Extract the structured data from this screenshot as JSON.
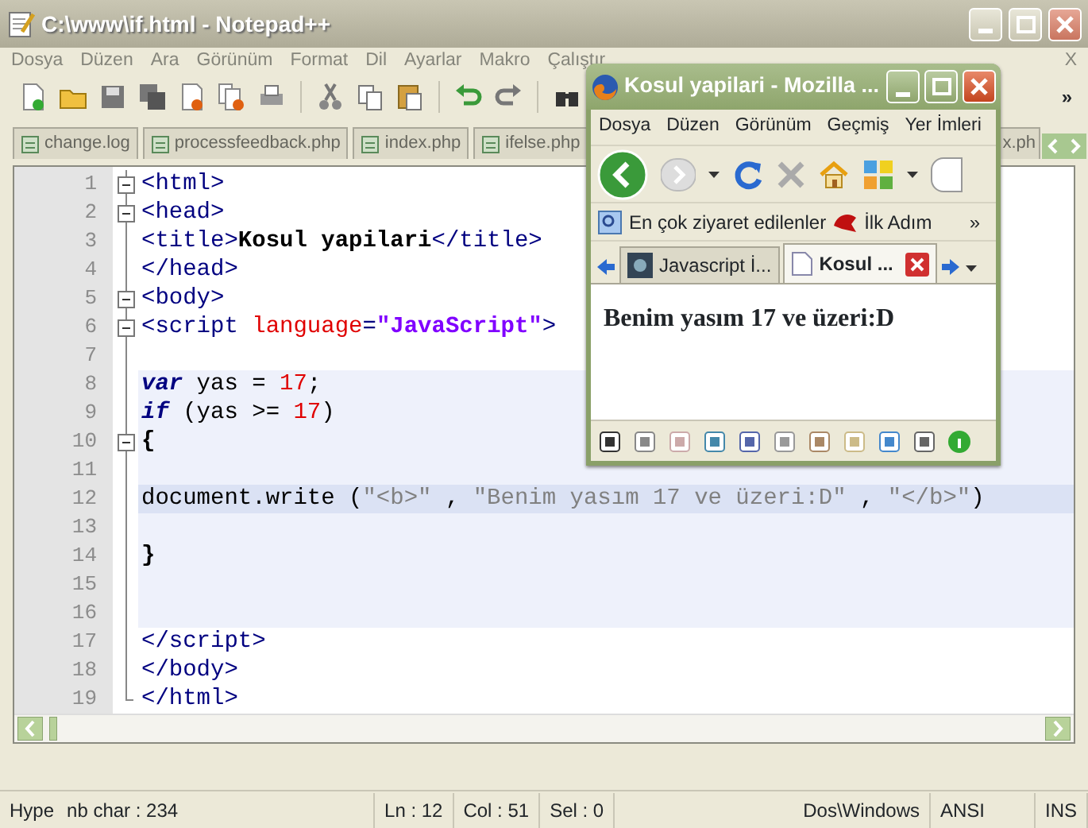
{
  "editor_window": {
    "title": "C:\\www\\if.html - Notepad++",
    "menu": [
      "Dosya",
      "Düzen",
      "Ara",
      "Görünüm",
      "Format",
      "Dil",
      "Ayarlar",
      "Makro",
      "Çalıştır"
    ],
    "menu_close": "X",
    "toolbar_overflow": "»",
    "tabs": [
      {
        "label": "change.log",
        "selected": false
      },
      {
        "label": "processfeedback.php",
        "selected": false
      },
      {
        "label": "index.php",
        "selected": false
      },
      {
        "label": "ifelse.php",
        "selected": false
      },
      {
        "label": "x.ph",
        "selected": false
      }
    ],
    "lines": [
      {
        "number": "1",
        "foldable": true,
        "shaded": false,
        "current": false,
        "tokens": [
          {
            "kind": "tag",
            "text": "<html>"
          }
        ]
      },
      {
        "number": "2",
        "foldable": true,
        "shaded": false,
        "current": false,
        "tokens": [
          {
            "kind": "tag",
            "text": "<head>"
          }
        ]
      },
      {
        "number": "3",
        "foldable": false,
        "shaded": false,
        "current": false,
        "tokens": [
          {
            "kind": "tag",
            "text": "<title>"
          },
          {
            "kind": "bold",
            "text": "Kosul yapilari"
          },
          {
            "kind": "tag",
            "text": "</title>"
          }
        ]
      },
      {
        "number": "4",
        "foldable": false,
        "shaded": false,
        "current": false,
        "tokens": [
          {
            "kind": "tag",
            "text": "</head>"
          }
        ]
      },
      {
        "number": "5",
        "foldable": true,
        "shaded": false,
        "current": false,
        "tokens": [
          {
            "kind": "tag",
            "text": "<body>"
          }
        ]
      },
      {
        "number": "6",
        "foldable": true,
        "shaded": false,
        "current": false,
        "tokens": [
          {
            "kind": "tag",
            "text": "<script "
          },
          {
            "kind": "attr",
            "text": "language"
          },
          {
            "kind": "tag",
            "text": "="
          },
          {
            "kind": "value",
            "text": "\"JavaScript\""
          },
          {
            "kind": "tag",
            "text": ">"
          }
        ]
      },
      {
        "number": "7",
        "foldable": false,
        "shaded": false,
        "current": false
      },
      {
        "number": "8",
        "foldable": false,
        "shaded": true,
        "current": false,
        "tokens": [
          {
            "kind": "keyword",
            "text": "var"
          },
          {
            "kind": "plain",
            "text": " yas = "
          },
          {
            "kind": "number",
            "text": "17"
          },
          {
            "kind": "plain",
            "text": ";"
          }
        ]
      },
      {
        "number": "9",
        "foldable": false,
        "shaded": true,
        "current": false,
        "tokens": [
          {
            "kind": "keyword",
            "text": "if"
          },
          {
            "kind": "plain",
            "text": " (yas >= "
          },
          {
            "kind": "number",
            "text": "17"
          },
          {
            "kind": "plain",
            "text": ")"
          }
        ]
      },
      {
        "number": "10",
        "foldable": true,
        "shaded": true,
        "current": false,
        "tokens": [
          {
            "kind": "bold",
            "text": "{"
          }
        ]
      },
      {
        "number": "11",
        "foldable": false,
        "shaded": true,
        "current": false
      },
      {
        "number": "12",
        "foldable": false,
        "shaded": true,
        "current": true,
        "tokens": [
          {
            "kind": "plain",
            "text": "document.write ("
          },
          {
            "kind": "string",
            "text": "\"<b>\" "
          },
          {
            "kind": "plain",
            "text": ", "
          },
          {
            "kind": "string",
            "text": "\"Benim yasım 17 ve üzeri:D\" "
          },
          {
            "kind": "plain",
            "text": ", "
          },
          {
            "kind": "string",
            "text": "\"</b>\""
          },
          {
            "kind": "plain",
            "text": ")"
          }
        ]
      },
      {
        "number": "13",
        "foldable": false,
        "shaded": true,
        "current": false
      },
      {
        "number": "14",
        "foldable": false,
        "shaded": true,
        "current": false,
        "tokens": [
          {
            "kind": "bold",
            "text": "}"
          }
        ]
      },
      {
        "number": "15",
        "foldable": false,
        "shaded": true,
        "current": false
      },
      {
        "number": "16",
        "foldable": false,
        "shaded": true,
        "current": false
      },
      {
        "number": "17",
        "foldable": false,
        "shaded": false,
        "current": false,
        "tokens": [
          {
            "kind": "tag",
            "text": "</script>"
          }
        ]
      },
      {
        "number": "18",
        "foldable": false,
        "shaded": false,
        "current": false,
        "tokens": [
          {
            "kind": "tag",
            "text": "</body>"
          }
        ]
      },
      {
        "number": "19",
        "foldable": false,
        "shaded": false,
        "current": false,
        "tokens": [
          {
            "kind": "tag",
            "text": "</html>"
          }
        ]
      }
    ],
    "status_bar": [
      "Hype",
      "nb char : 234",
      "Ln : 12",
      "Col : 51",
      "Sel : 0",
      "Dos\\Windows",
      "ANSI",
      "INS"
    ]
  },
  "browser_window": {
    "title": "Kosul yapilari - Mozilla ...",
    "menu": [
      "Dosya",
      "Düzen",
      "Görünüm",
      "Geçmiş",
      "Yer İmleri"
    ],
    "bookmarks": [
      "En çok ziyaret edilenler",
      "İlk Adım"
    ],
    "bookmarks_overflow": "»",
    "tabs": [
      {
        "label": "Javascript İ...",
        "selected": false
      },
      {
        "label": "Kosul ...",
        "selected": true
      }
    ],
    "content": "Benim yasım 17 ve üzeri:D"
  }
}
